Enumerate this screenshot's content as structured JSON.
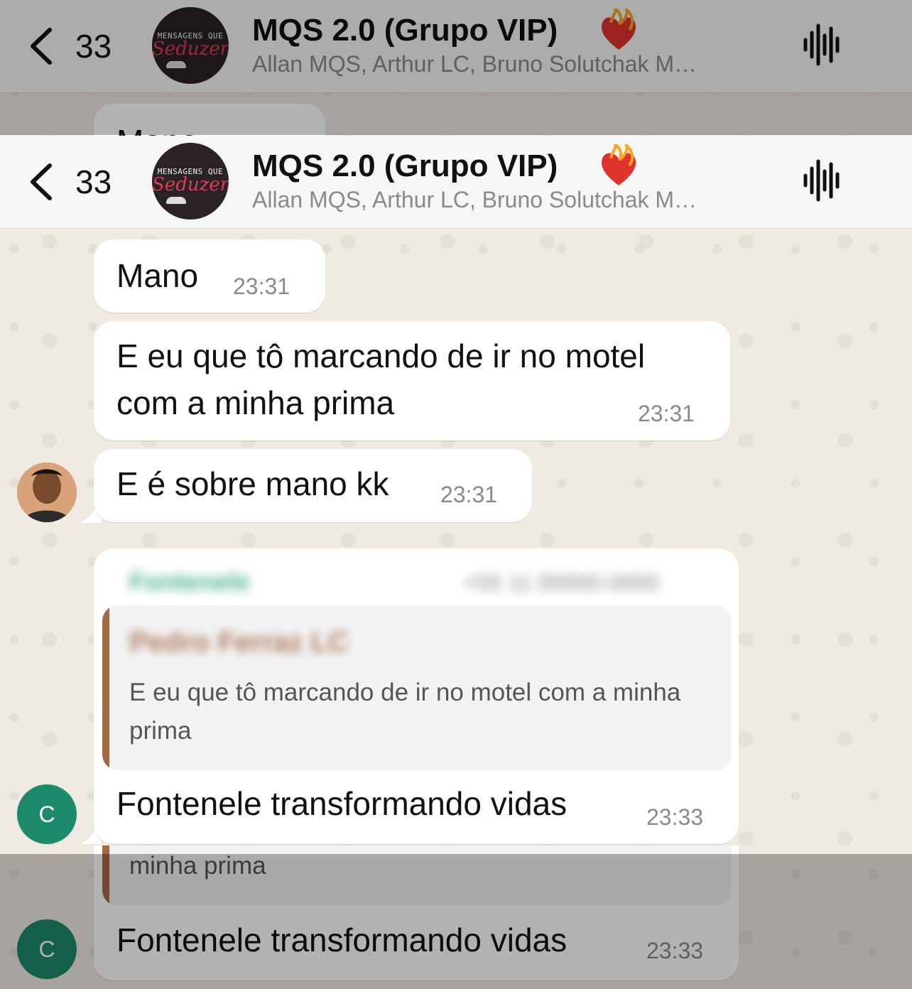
{
  "header": {
    "back_count": "33",
    "title": "MQS 2.0 (Grupo VIP)",
    "members": "Allan MQS, Arthur LC, Bruno Solutchak M…",
    "avatar_line1": "MENSAGENS QUE",
    "avatar_line2": "Seduzem"
  },
  "messages": [
    {
      "text": "Mano",
      "time": "23:31"
    },
    {
      "text": "E eu que tô marcando de ir no motel com a minha prima",
      "time": "23:31"
    },
    {
      "text": "E é sobre mano kk",
      "time": "23:31"
    },
    {
      "sender_name": "Fontenele",
      "sender_phone": "+55 11 00000-0000",
      "avatar_letter": "C",
      "quote_author": "Pedro Ferraz LC",
      "quote_text": "E eu que tô marcando de ir no motel com a minha prima",
      "text": "Fontenele transformando vidas",
      "time": "23:33"
    }
  ],
  "ghost_bottom": {
    "quote_tail": "minha prima",
    "text": "Fontenele transformando vidas",
    "time": "23:33",
    "avatar_letter": "C"
  },
  "ghost_top_partial": "Mano",
  "colors": {
    "accent_green": "#1e8a6c",
    "quote_bar": "#a56a44"
  }
}
